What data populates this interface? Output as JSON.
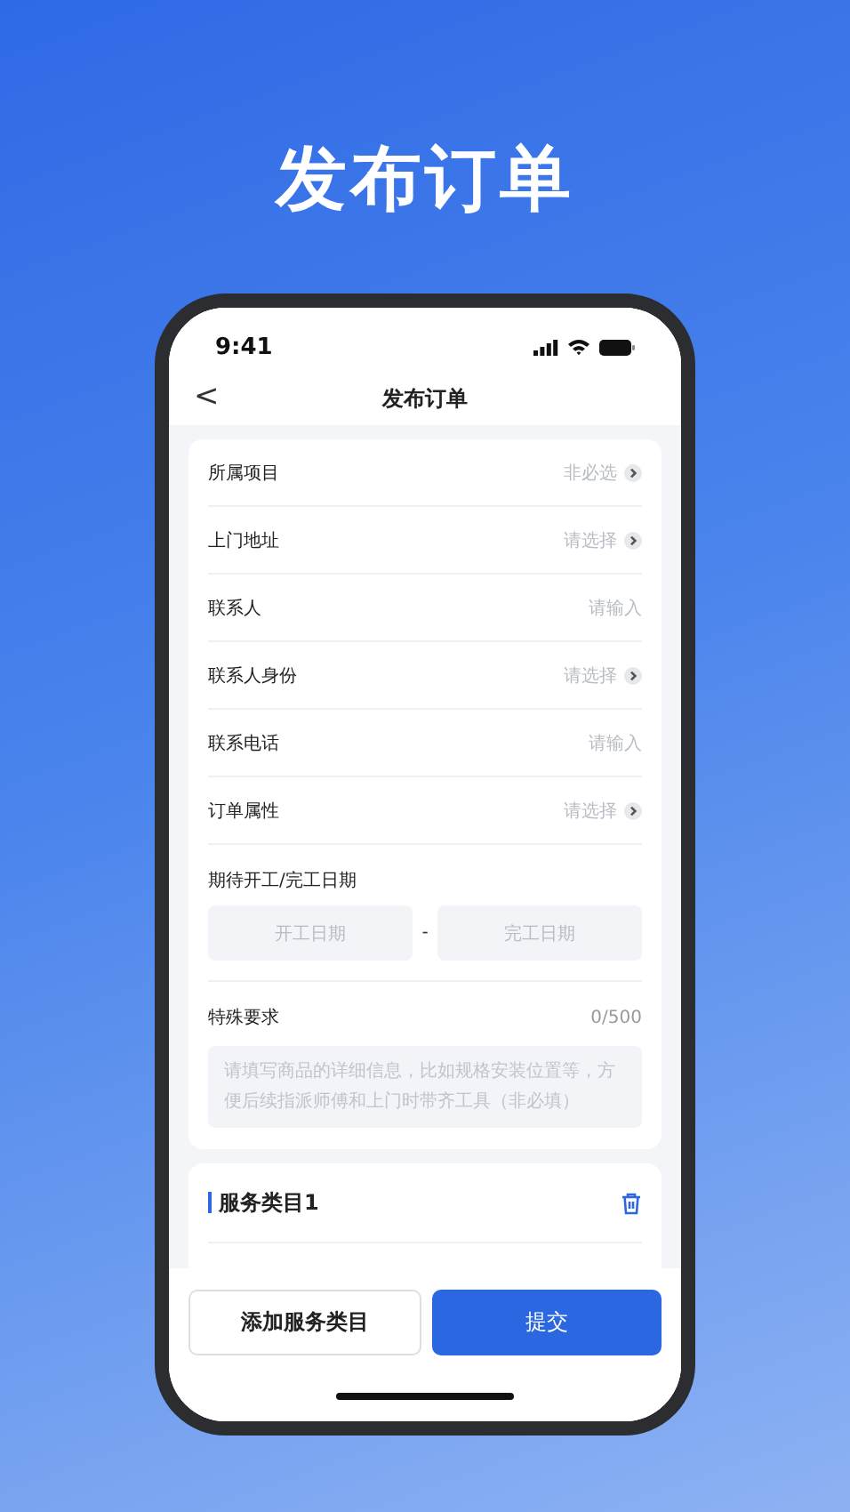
{
  "headline": "发布订单",
  "status_bar": {
    "time": "9:41"
  },
  "nav": {
    "back": "<",
    "title": "发布订单"
  },
  "form_rows": [
    {
      "kind": "select",
      "label": "所属项目",
      "placeholder": "非必选"
    },
    {
      "kind": "select",
      "label": "上门地址",
      "placeholder": "请选择"
    },
    {
      "kind": "input",
      "label": "联系人",
      "placeholder": "请输入"
    },
    {
      "kind": "select",
      "label": "联系人身份",
      "placeholder": "请选择"
    },
    {
      "kind": "input",
      "label": "联系电话",
      "placeholder": "请输入"
    },
    {
      "kind": "select",
      "label": "订单属性",
      "placeholder": "请选择"
    }
  ],
  "date_range": {
    "label": "期待开工/完工日期",
    "start_placeholder": "开工日期",
    "separator": "-",
    "end_placeholder": "完工日期"
  },
  "special_requirements": {
    "label": "特殊要求",
    "counter": "0/500",
    "placeholder": "请填写商品的详细信息，比如规格安装位置等，方便后续指派师傅和上门时带齐工具（非必填）"
  },
  "service_section": {
    "title": "服务类目1"
  },
  "buttons": [
    {
      "kind": "secondary",
      "label": "添加服务类目"
    },
    {
      "kind": "primary",
      "label": "提交"
    }
  ]
}
